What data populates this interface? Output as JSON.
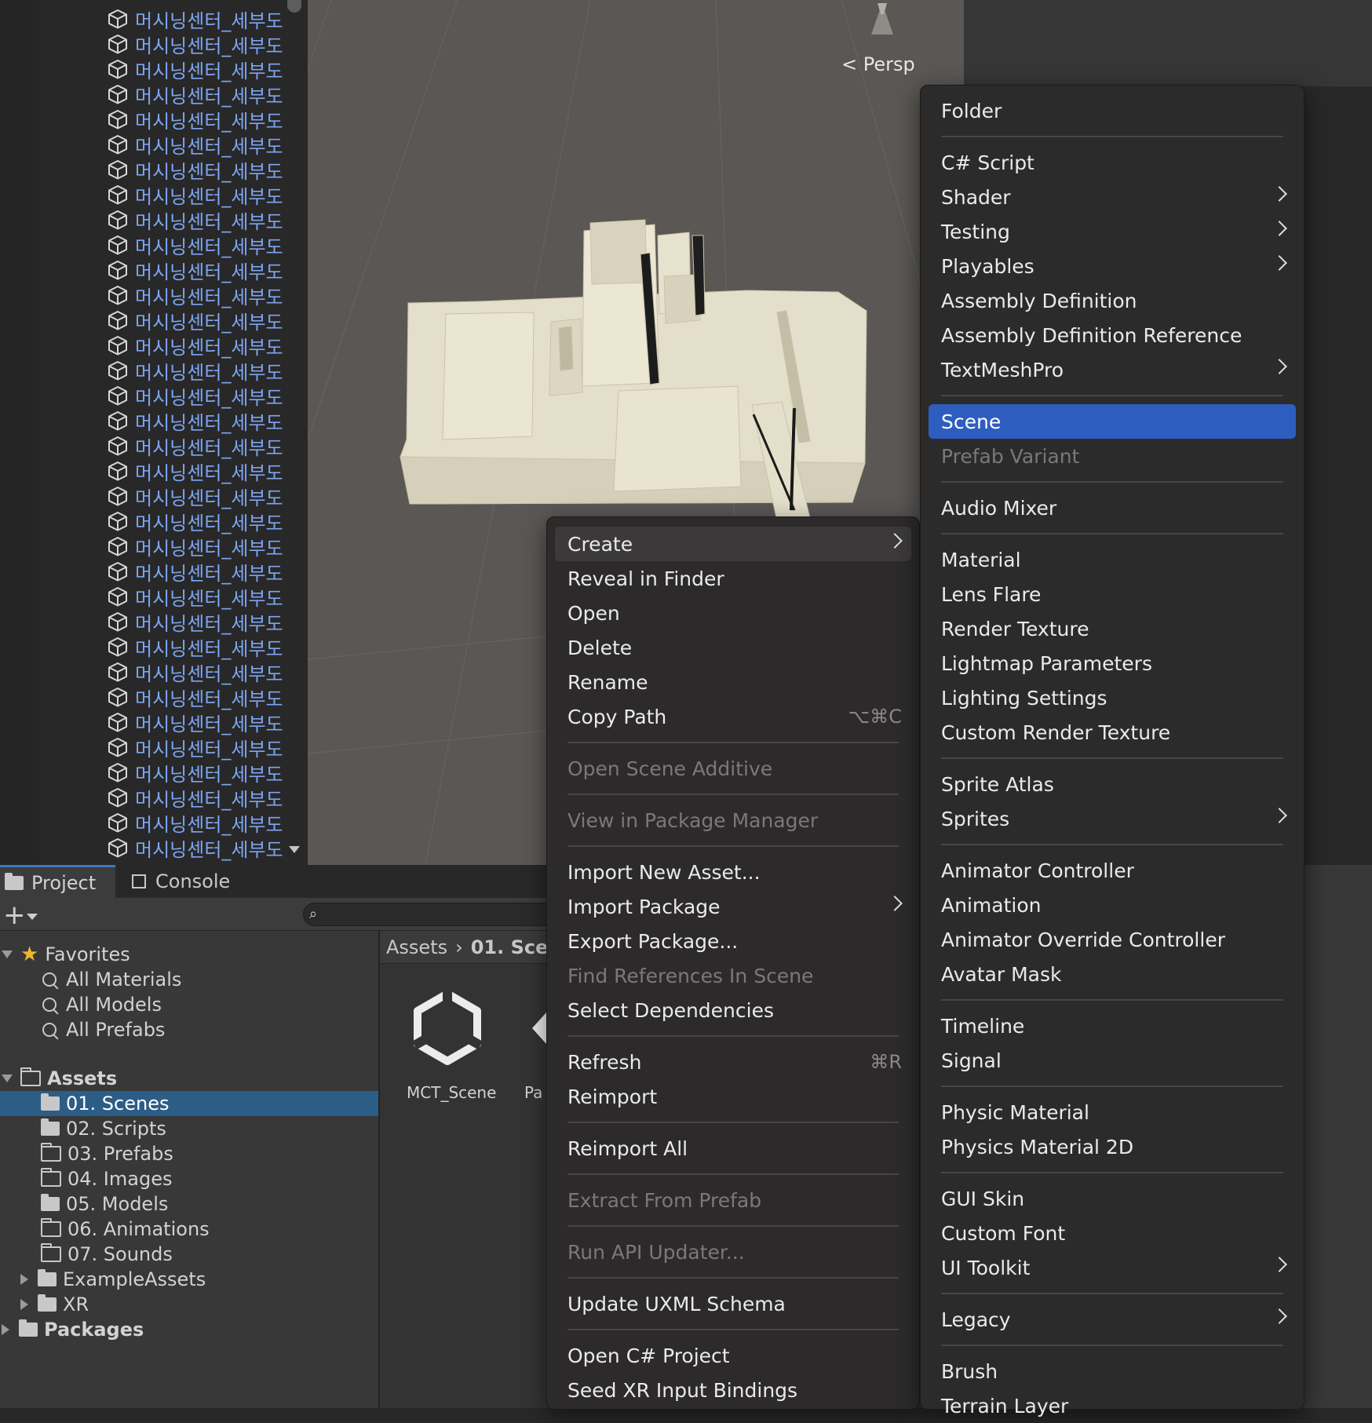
{
  "hierarchy": {
    "item_label": "머시닝센터_세부도",
    "rows": 34
  },
  "scene": {
    "projection_label": "Persp"
  },
  "project": {
    "tabs": [
      "Project",
      "Console"
    ],
    "search_placeholder": "",
    "favorites": {
      "label": "Favorites",
      "items": [
        "All Materials",
        "All Models",
        "All Prefabs"
      ]
    },
    "assets": {
      "label": "Assets",
      "folders": [
        "01. Scenes",
        "02. Scripts",
        "03. Prefabs",
        "04. Images",
        "05. Models",
        "06. Animations",
        "07. Sounds",
        "ExampleAssets",
        "XR"
      ],
      "selected": "01. Scenes"
    },
    "packages_label": "Packages",
    "breadcrumb": [
      "Assets",
      "01. Scenes"
    ],
    "content_items": [
      "MCT_Scene",
      "Pa"
    ]
  },
  "context_menu": {
    "items": [
      {
        "label": "Create",
        "submenu": true,
        "hover": true
      },
      {
        "label": "Reveal in Finder"
      },
      {
        "label": "Open"
      },
      {
        "label": "Delete"
      },
      {
        "label": "Rename"
      },
      {
        "label": "Copy Path",
        "shortcut": "⌥⌘C"
      },
      {
        "sep": true
      },
      {
        "label": "Open Scene Additive",
        "disabled": true
      },
      {
        "sep": true
      },
      {
        "label": "View in Package Manager",
        "disabled": true
      },
      {
        "sep": true
      },
      {
        "label": "Import New Asset..."
      },
      {
        "label": "Import Package",
        "submenu": true
      },
      {
        "label": "Export Package..."
      },
      {
        "label": "Find References In Scene",
        "disabled": true
      },
      {
        "label": "Select Dependencies"
      },
      {
        "sep": true
      },
      {
        "label": "Refresh",
        "shortcut": "⌘R"
      },
      {
        "label": "Reimport"
      },
      {
        "sep": true
      },
      {
        "label": "Reimport All"
      },
      {
        "sep": true
      },
      {
        "label": "Extract From Prefab",
        "disabled": true
      },
      {
        "sep": true
      },
      {
        "label": "Run API Updater...",
        "disabled": true
      },
      {
        "sep": true
      },
      {
        "label": "Update UXML Schema"
      },
      {
        "sep": true
      },
      {
        "label": "Open C# Project"
      },
      {
        "label": "Seed XR Input Bindings"
      }
    ]
  },
  "create_submenu": {
    "items": [
      {
        "label": "Folder"
      },
      {
        "sep": true
      },
      {
        "label": "C# Script"
      },
      {
        "label": "Shader",
        "submenu": true
      },
      {
        "label": "Testing",
        "submenu": true
      },
      {
        "label": "Playables",
        "submenu": true
      },
      {
        "label": "Assembly Definition"
      },
      {
        "label": "Assembly Definition Reference"
      },
      {
        "label": "TextMeshPro",
        "submenu": true
      },
      {
        "sep": true
      },
      {
        "label": "Scene",
        "highlighted": true
      },
      {
        "label": "Prefab Variant",
        "disabled": true
      },
      {
        "sep": true
      },
      {
        "label": "Audio Mixer"
      },
      {
        "sep": true
      },
      {
        "label": "Material"
      },
      {
        "label": "Lens Flare"
      },
      {
        "label": "Render Texture"
      },
      {
        "label": "Lightmap Parameters"
      },
      {
        "label": "Lighting Settings"
      },
      {
        "label": "Custom Render Texture"
      },
      {
        "sep": true
      },
      {
        "label": "Sprite Atlas"
      },
      {
        "label": "Sprites",
        "submenu": true
      },
      {
        "sep": true
      },
      {
        "label": "Animator Controller"
      },
      {
        "label": "Animation"
      },
      {
        "label": "Animator Override Controller"
      },
      {
        "label": "Avatar Mask"
      },
      {
        "sep": true
      },
      {
        "label": "Timeline"
      },
      {
        "label": "Signal"
      },
      {
        "sep": true
      },
      {
        "label": "Physic Material"
      },
      {
        "label": "Physics Material 2D"
      },
      {
        "sep": true
      },
      {
        "label": "GUI Skin"
      },
      {
        "label": "Custom Font"
      },
      {
        "label": "UI Toolkit",
        "submenu": true
      },
      {
        "sep": true
      },
      {
        "label": "Legacy",
        "submenu": true
      },
      {
        "sep": true
      },
      {
        "label": "Brush"
      },
      {
        "label": "Terrain Layer"
      }
    ]
  }
}
